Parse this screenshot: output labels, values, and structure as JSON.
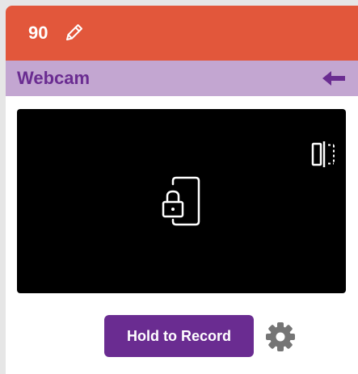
{
  "header": {
    "count": "90",
    "edit_icon": "pencil-icon",
    "color": "#e2573b"
  },
  "panel": {
    "title": "Webcam",
    "back_icon": "arrow-left-icon",
    "color": "#c3a6d1",
    "accent": "#6a2c91"
  },
  "preview": {
    "flip_icon": "flip-horizontal-icon",
    "center_icon": "phone-lock-icon",
    "background": "#000000"
  },
  "controls": {
    "record_label": "Hold to Record",
    "settings_icon": "gear-icon"
  }
}
